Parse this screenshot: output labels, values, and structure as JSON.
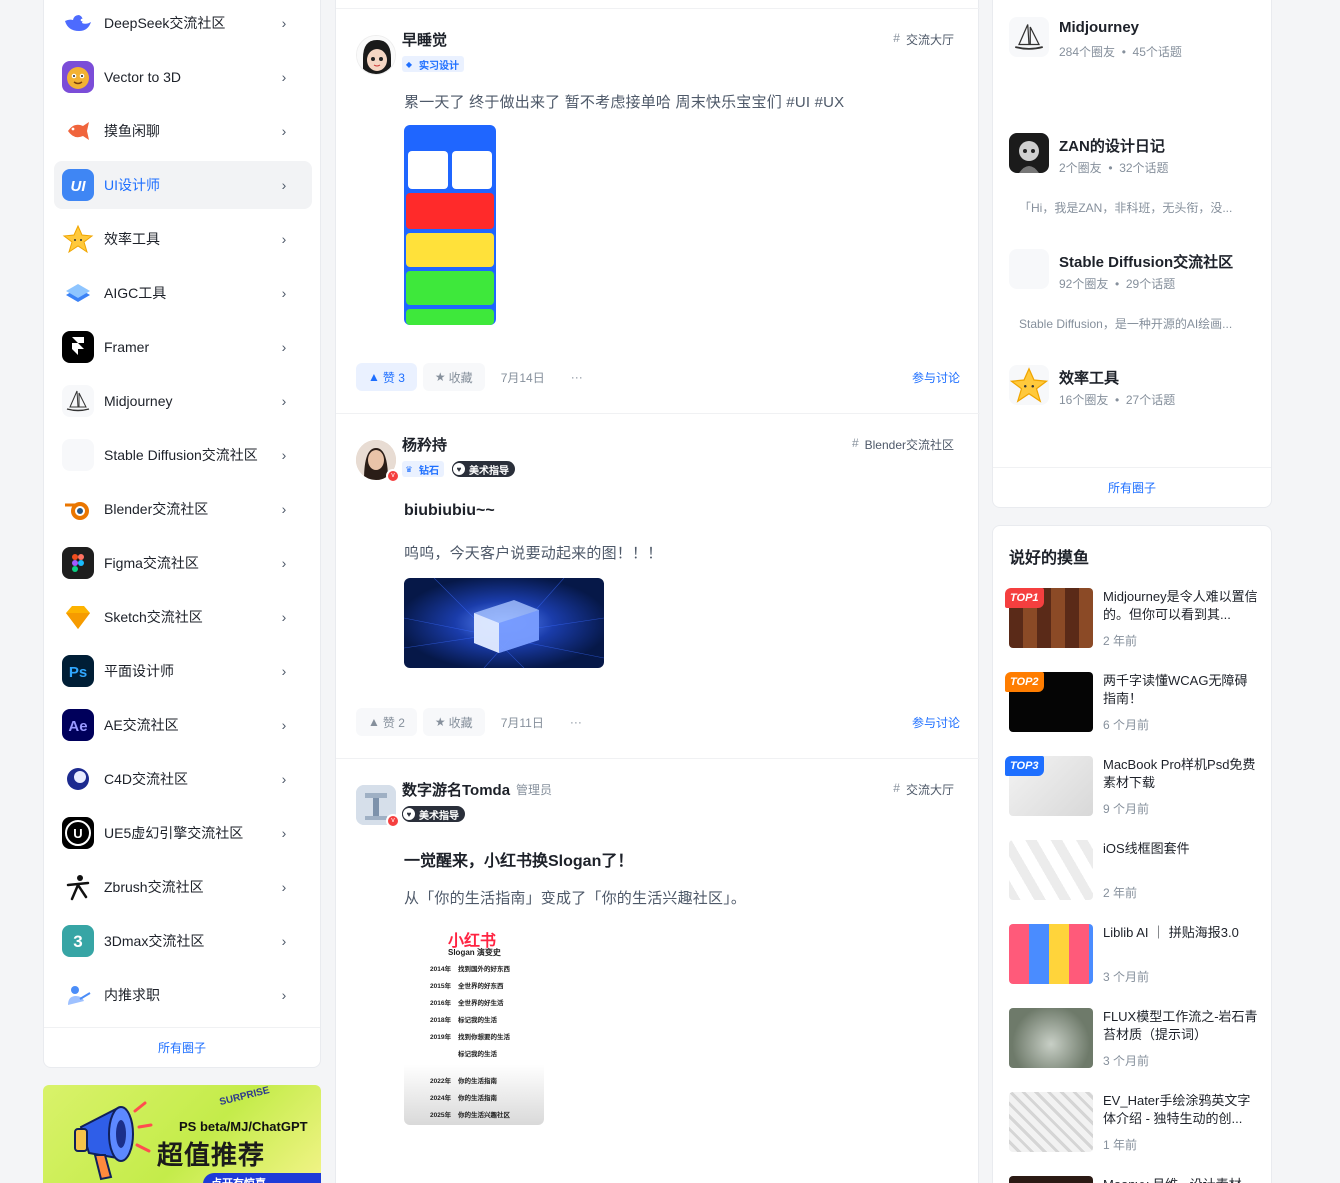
{
  "sidebar": {
    "items": [
      {
        "label": "DeepSeek交流社区",
        "icon": "deepseek-whale-icon",
        "bg": "#ffffff"
      },
      {
        "label": "Vector to 3D",
        "icon": "vector-3d-icon",
        "bg": "#7b4dd8"
      },
      {
        "label": "摸鱼闲聊",
        "icon": "fish-icon",
        "bg": "#ffffff"
      },
      {
        "label": "UI设计师",
        "icon": "ui-designer-icon",
        "bg": "#3f86f4"
      },
      {
        "label": "效率工具",
        "icon": "star-icon",
        "bg": "#ffffff"
      },
      {
        "label": "AIGC工具",
        "icon": "aigc-icon",
        "bg": "#ffffff"
      },
      {
        "label": "Framer",
        "icon": "framer-icon",
        "bg": "#000000"
      },
      {
        "label": "Midjourney",
        "icon": "midjourney-boat-icon",
        "bg": "#f7f8fa"
      },
      {
        "label": "Stable Diffusion交流社区",
        "icon": "stable-diffusion-icon",
        "bg": "#f7f8fa"
      },
      {
        "label": "Blender交流社区",
        "icon": "blender-icon",
        "bg": "#ffffff"
      },
      {
        "label": "Figma交流社区",
        "icon": "figma-icon",
        "bg": "#1e1e1e"
      },
      {
        "label": "Sketch交流社区",
        "icon": "sketch-diamond-icon",
        "bg": "#ffffff"
      },
      {
        "label": "平面设计师",
        "icon": "photoshop-icon",
        "bg": "#001e36"
      },
      {
        "label": "AE交流社区",
        "icon": "after-effects-icon",
        "bg": "#00005b"
      },
      {
        "label": "C4D交流社区",
        "icon": "c4d-icon",
        "bg": "#ffffff"
      },
      {
        "label": "UE5虚幻引擎交流社区",
        "icon": "unreal-engine-icon",
        "bg": "#000000"
      },
      {
        "label": "Zbrush交流社区",
        "icon": "zbrush-icon",
        "bg": "#ffffff"
      },
      {
        "label": "3Dmax交流社区",
        "icon": "3dmax-icon",
        "bg": "#37a5a5"
      },
      {
        "label": "内推求职",
        "icon": "job-icon",
        "bg": "#ffffff"
      }
    ],
    "active_index": 3,
    "footer_label": "所有圈子",
    "chevron": "›"
  },
  "banner": {
    "tag": "SURPRISE",
    "line1": "PS beta/MJ/ChatGPT",
    "line2": "超值推荐",
    "pill": "点开有惊喜"
  },
  "feed": {
    "posts": [
      {
        "author": "早睡觉",
        "badges": [
          {
            "style": "blue",
            "icon": "diamond-shield-icon",
            "text": "实习设计"
          }
        ],
        "circle": "交流大厅",
        "title": "",
        "text": "累一天了 终于做出来了 暂不考虑接单哈 周末快乐宝宝们 #UI #UX",
        "image": "app-ui-screenshot",
        "likes": "赞 3",
        "liked": true,
        "fav": "收藏",
        "date": "7月14日",
        "more": "···",
        "discuss": "参与讨论"
      },
      {
        "author": "杨矜持",
        "badges": [
          {
            "style": "blue",
            "icon": "crown-icon",
            "text": "钻石"
          },
          {
            "style": "dark",
            "icon": "art-guide-icon",
            "text": "美术指导"
          }
        ],
        "circle": "Blender交流社区",
        "title": "biubiubiu~~",
        "text": "呜呜，今天客户说要动起来的图！！！",
        "image": "blue-3d-building-render",
        "likes": "赞 2",
        "liked": false,
        "fav": "收藏",
        "date": "7月11日",
        "more": "···",
        "discuss": "参与讨论"
      },
      {
        "author": "数字游名Tomda",
        "admin": "管理员",
        "badges": [
          {
            "style": "dark",
            "icon": "art-guide-icon",
            "text": "美术指导"
          }
        ],
        "circle": "交流大厅",
        "title": "一觉醒来，小红书换Slogan了！",
        "text": "从「你的生活指南」变成了「你的生活兴趣社区」。",
        "image": "xiaohongshu-slogan-history",
        "image_lines": {
          "brand": "小红书",
          "subtitle": "Slogan 演变史",
          "rows": [
            {
              "year": "2014年",
              "text": "找到国外的好东西"
            },
            {
              "year": "2015年",
              "text": "全世界的好东西"
            },
            {
              "year": "2016年",
              "text": "全世界的好生活"
            },
            {
              "year": "2018年",
              "text": "标记我的生活"
            },
            {
              "year": "2019年",
              "text": "找到你想要的生活"
            },
            {
              "year": "",
              "text": "标记我的生活"
            },
            {
              "year": "2022年",
              "text": "你的生活指南"
            },
            {
              "year": "2024年",
              "text": "你的生活指南"
            },
            {
              "year": "2025年",
              "text": "你的生活兴趣社区"
            }
          ]
        }
      }
    ]
  },
  "groups": {
    "items": [
      {
        "name": "Midjourney",
        "stats": "284个圈友  •  45个话题",
        "desc": "",
        "icon": "midjourney-boat-icon"
      },
      {
        "name": "ZAN的设计日记",
        "stats": "2个圈友  •  32个话题",
        "desc": "「Hi，我是ZAN，非科班，无头衔，没...",
        "icon": "zan-avatar-icon"
      },
      {
        "name": "Stable Diffusion交流社区",
        "stats": "92个圈友  •  29个话题",
        "desc": "Stable Diffusion，是一种开源的AI绘画...",
        "icon": "stable-diffusion-icon"
      },
      {
        "name": "效率工具",
        "stats": "16个圈友  •  27个话题",
        "desc": "",
        "icon": "star-icon"
      }
    ],
    "footer_label": "所有圈子"
  },
  "hot": {
    "title": "说好的摸鱼",
    "items": [
      {
        "title": "Midjourney是令人难以置信的。但你可以看到其...",
        "time": "2 年前",
        "rank": "TOP1",
        "rank_color": "#f53f3f",
        "thumb": "portrait-grid-thumb"
      },
      {
        "title": "两千字读懂WCAG无障碍指南！",
        "time": "6 个月前",
        "rank": "TOP2",
        "rank_color": "#ff7d00",
        "thumb": "wcag-dark-thumb"
      },
      {
        "title": "MacBook Pro样机Psd免费素材下载",
        "time": "9 个月前",
        "rank": "TOP3",
        "rank_color": "#1e6fff",
        "thumb": "macbook-mockup-thumb"
      },
      {
        "title": "iOS线框图套件",
        "time": "2 年前",
        "rank": "",
        "rank_color": "",
        "thumb": "ios-wireframe-thumb"
      },
      {
        "title": "Liblib AI ｜ 拼贴海报3.0",
        "time": "3 个月前",
        "rank": "",
        "rank_color": "",
        "thumb": "collage-poster-thumb"
      },
      {
        "title": "FLUX模型工作流之-岩石青苔材质（提示词）",
        "time": "3 个月前",
        "rank": "",
        "rank_color": "",
        "thumb": "moss-rock-thumb"
      },
      {
        "title": "EV_Hater手绘涂鸦英文字体介绍 - 独特生动的创...",
        "time": "1 年前",
        "rank": "",
        "rank_color": "",
        "thumb": "graffiti-font-thumb"
      },
      {
        "title": "Moonvy 月维 - 设计素材...",
        "time": "",
        "rank": "",
        "rank_color": "",
        "thumb": "moonvy-thumb"
      }
    ]
  }
}
